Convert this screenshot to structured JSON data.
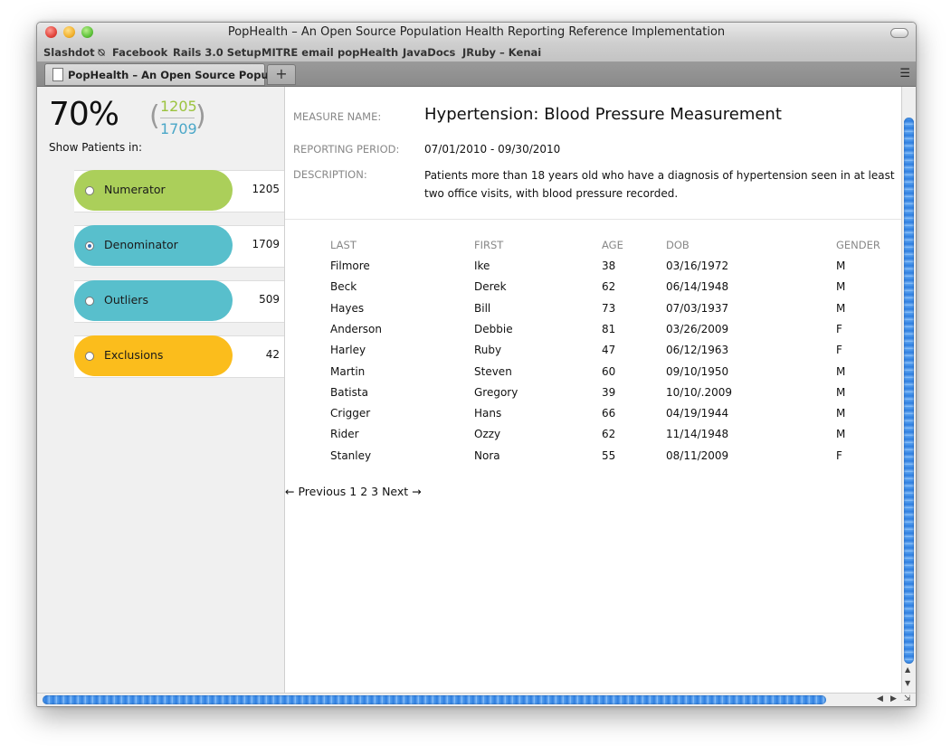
{
  "window": {
    "title": "PopHealth – An Open Source Population Health Reporting Reference Implementation"
  },
  "bookmarks": [
    "Slashdot ⍉",
    "Facebook",
    "Rails 3.0 Setup",
    "MITRE email",
    "popHealth",
    "JavaDocs",
    "JRuby – Kenai"
  ],
  "tabs": {
    "active_label": "PopHealth – An Open Source Popu…",
    "new_tab": "+",
    "menu_icon": "tab-list-icon"
  },
  "summary": {
    "percent": "70%",
    "numerator": "1205",
    "denominator": "1709",
    "open_paren": "(",
    "close_paren": ")",
    "show_label": "Show Patients in:"
  },
  "categories": [
    {
      "label": "Numerator",
      "count": "1205",
      "color": "#abcf5a",
      "selected": false
    },
    {
      "label": "Denominator",
      "count": "1709",
      "color": "#58bfcc",
      "selected": true
    },
    {
      "label": "Outliers",
      "count": "509",
      "color": "#58bfcc",
      "selected": false
    },
    {
      "label": "Exclusions",
      "count": "42",
      "color": "#fbbd1c",
      "selected": false
    }
  ],
  "measure": {
    "name_label": "MEASURE NAME:",
    "name": "Hypertension: Blood Pressure Measurement",
    "period_label": "REPORTING PERIOD:",
    "period": "07/01/2010 - 09/30/2010",
    "description_label": "DESCRIPTION:",
    "description": "Patients more than 18 years old who have a diagnosis of hypertension seen in at least two office visits, with blood pressure recorded."
  },
  "table": {
    "headers": {
      "last": "LAST",
      "first": "FIRST",
      "age": "AGE",
      "dob": "DOB",
      "gender": "GENDER"
    },
    "rows": [
      {
        "last": "Filmore",
        "first": "Ike",
        "age": "38",
        "dob": "03/16/1972",
        "gender": "M"
      },
      {
        "last": "Beck",
        "first": "Derek",
        "age": "62",
        "dob": "06/14/1948",
        "gender": "M"
      },
      {
        "last": "Hayes",
        "first": "Bill",
        "age": "73",
        "dob": "07/03/1937",
        "gender": "M"
      },
      {
        "last": "Anderson",
        "first": "Debbie",
        "age": "81",
        "dob": "03/26/2009",
        "gender": "F"
      },
      {
        "last": "Harley",
        "first": "Ruby",
        "age": "47",
        "dob": "06/12/1963",
        "gender": "F"
      },
      {
        "last": "Martin",
        "first": "Steven",
        "age": "60",
        "dob": "09/10/1950",
        "gender": "M"
      },
      {
        "last": "Batista",
        "first": "Gregory",
        "age": "39",
        "dob": "10/10/.2009",
        "gender": "M"
      },
      {
        "last": "Crigger",
        "first": "Hans",
        "age": "66",
        "dob": "04/19/1944",
        "gender": "M"
      },
      {
        "last": "Rider",
        "first": "Ozzy",
        "age": "62",
        "dob": "11/14/1948",
        "gender": "M"
      },
      {
        "last": "Stanley",
        "first": "Nora",
        "age": "55",
        "dob": "08/11/2009",
        "gender": "F"
      }
    ]
  },
  "pagination": {
    "previous": "← Previous",
    "pages": [
      "1",
      "2",
      "3"
    ],
    "next": "Next →"
  }
}
